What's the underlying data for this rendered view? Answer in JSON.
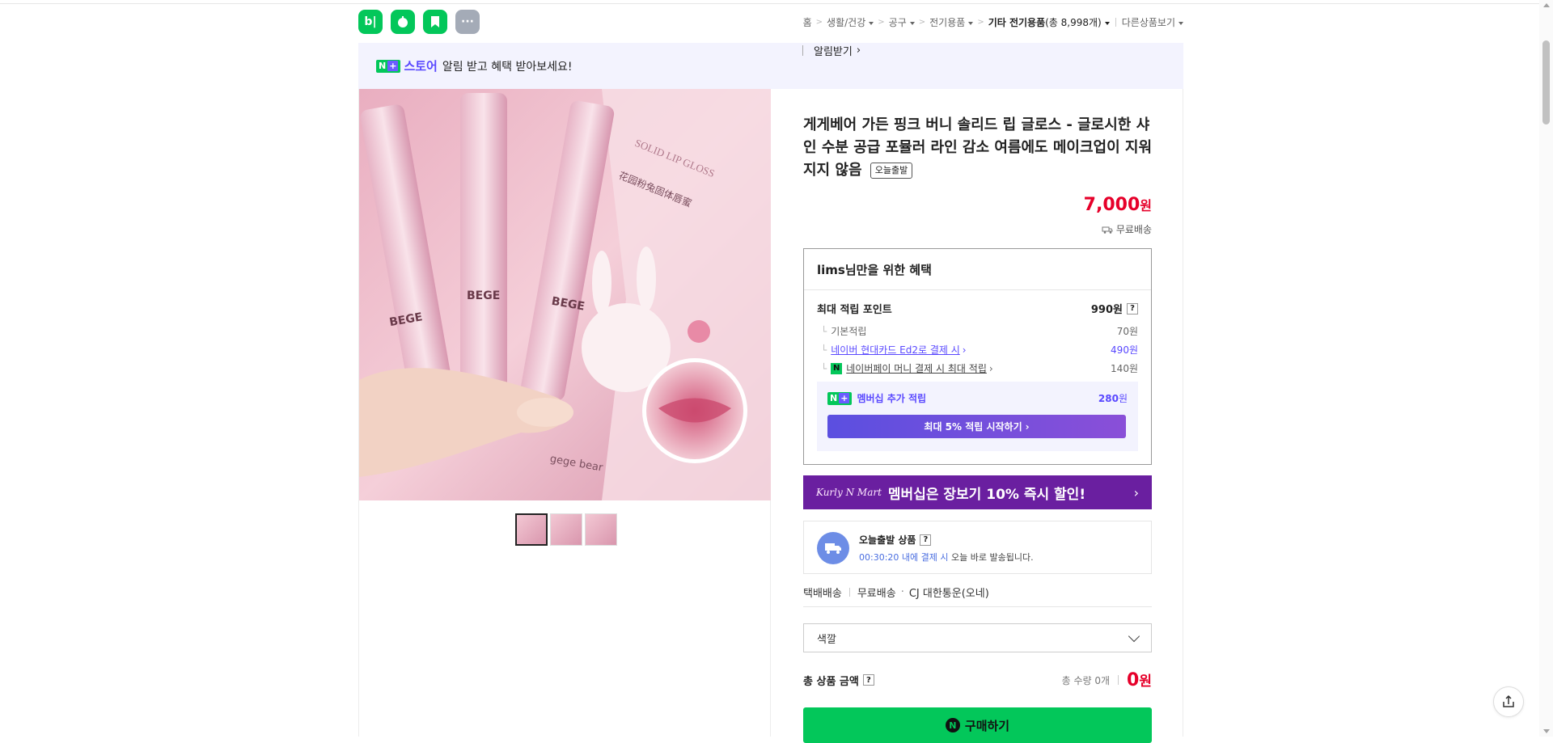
{
  "apps": [
    {
      "name": "blog",
      "glyph": "b|"
    },
    {
      "name": "cafe",
      "glyph": "☕"
    },
    {
      "name": "bookmark",
      "glyph": "▶"
    },
    {
      "name": "more",
      "glyph": "···"
    }
  ],
  "breadcrumb": {
    "home": "홈",
    "c1": "생활/건강",
    "c2": "공구",
    "c3": "전기용품",
    "c4": "기타 전기용품",
    "c4_count": "(총 8,998개)",
    "other": "다른상품보기"
  },
  "banner": {
    "n_badge": "N",
    "plus_badge": "+",
    "store": "스토어",
    "message": "알림 받고 혜택 받아보세요!",
    "alarm": "알림받기"
  },
  "product": {
    "title": "게게베어 가든 핑크 버니 솔리드 립 글로스 - 글로시한 샤인 수분 공급 포뮬러 라인 감소 여름에도 메이크업이 지워지지 않음",
    "today_tag": "오늘출발",
    "price": "7,000",
    "price_unit": "원",
    "shipping": "무료배송"
  },
  "benefit": {
    "heading": "lims님만을 위한 혜택",
    "max_points_label": "최대 적립 포인트",
    "max_points_value": "990원",
    "help": "?",
    "basic_label": "기본적립",
    "basic_value": "70원",
    "card_label": "네이버 현대카드 Ed2로 결제 시",
    "card_value": "490원",
    "npay_label": "네이버페이 머니 결제 시 최대 적립",
    "npay_value": "140원",
    "npay_badge": "N",
    "member_label": "멤버십 추가 적립",
    "member_value": "280",
    "member_unit": "원",
    "member_cta": "최대 5% 적립 시작하기"
  },
  "kurly": {
    "logo": "Kurly N Mart",
    "text": "멤버십은 장보기 10% 즉시 할인!"
  },
  "dispatch": {
    "title": "오늘출발 상품",
    "help": "?",
    "time": "00:30:20 내에 결제 시",
    "rest": "오늘 바로 발송됩니다."
  },
  "delivery": {
    "type": "택배배송",
    "fee": "무료배송",
    "carrier": "CJ 대한통운(오네)"
  },
  "option": {
    "placeholder": "색깔"
  },
  "total": {
    "label": "총 상품 금액",
    "help": "?",
    "qty": "총 수량 0개",
    "amount": "0",
    "unit": "원"
  },
  "buy": {
    "label": "구매하기",
    "badge": "N"
  },
  "image": {
    "box_text": "SOLID LIP GLOSS",
    "box_cn": "花园粉兔固体唇蜜",
    "brand": "BEGE",
    "tube_bear": "gege bear"
  },
  "colors": {
    "naver_green": "#03c75a",
    "price_red": "#e6002a",
    "accent_purple": "#5948ff",
    "kurly_purple": "#6a1fa0"
  }
}
